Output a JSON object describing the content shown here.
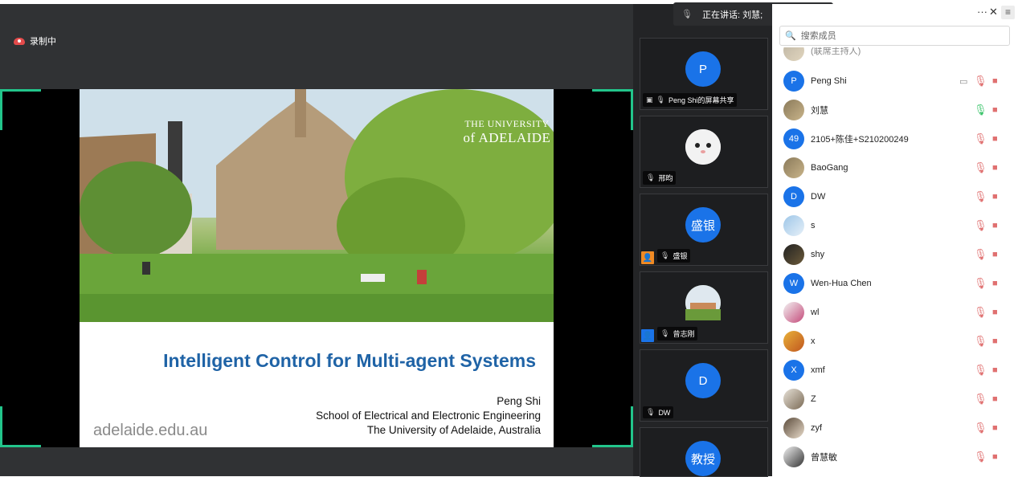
{
  "recording": {
    "label": "录制中"
  },
  "speaking": {
    "label": "正在讲话: 刘慧;"
  },
  "slide": {
    "university_line1": "THE UNIVERSITY",
    "university_line2": "of ADELAIDE",
    "title": "Intelligent Control for Multi-agent Systems",
    "author": "Peng Shi",
    "dept": "School of Electrical and Electronic Engineering",
    "affiliation": "The University of Adelaide, Australia",
    "url": "adelaide.edu.au"
  },
  "tiles": [
    {
      "avatar_text": "P",
      "name": "Peng Shi的屏幕共享",
      "kind": "letter"
    },
    {
      "avatar_text": "",
      "name": "邢昀",
      "kind": "photo"
    },
    {
      "avatar_text": "盛银",
      "name": "盛银",
      "kind": "letter"
    },
    {
      "avatar_text": "",
      "name": "曾志刚",
      "kind": "photo"
    },
    {
      "avatar_text": "D",
      "name": "DW",
      "kind": "letter"
    },
    {
      "avatar_text": "教授",
      "name": "",
      "kind": "letter"
    }
  ],
  "panel": {
    "more": "···",
    "close": "✕",
    "menu": "≡",
    "search_placeholder": "搜索成员"
  },
  "participants": [
    {
      "avatar": "",
      "name": "(联席主持人)",
      "mic": "muted",
      "partial": true
    },
    {
      "avatar": "P",
      "name": "Peng Shi",
      "mic": "muted",
      "screen": true
    },
    {
      "avatar": "",
      "name": "刘慧",
      "mic": "on"
    },
    {
      "avatar": "49",
      "name": "2105+陈佳+S210200249",
      "mic": "muted"
    },
    {
      "avatar": "",
      "name": "BaoGang",
      "mic": "muted"
    },
    {
      "avatar": "D",
      "name": "DW",
      "mic": "muted"
    },
    {
      "avatar": "",
      "name": "s",
      "mic": "muted"
    },
    {
      "avatar": "",
      "name": "shy",
      "mic": "muted"
    },
    {
      "avatar": "W",
      "name": "Wen-Hua Chen",
      "mic": "muted"
    },
    {
      "avatar": "",
      "name": "wl",
      "mic": "muted"
    },
    {
      "avatar": "",
      "name": "x",
      "mic": "muted"
    },
    {
      "avatar": "X",
      "name": "xmf",
      "mic": "muted"
    },
    {
      "avatar": "",
      "name": "Z",
      "mic": "muted"
    },
    {
      "avatar": "",
      "name": "zyf",
      "mic": "muted"
    },
    {
      "avatar": "",
      "name": "曾慧敏",
      "mic": "muted"
    }
  ],
  "colors": {
    "accent_blue": "#1a73e8",
    "share_border": "#22c58b",
    "muted_red": "#e07070",
    "mic_green": "#3cc46b",
    "title_blue": "#1f63a6"
  }
}
